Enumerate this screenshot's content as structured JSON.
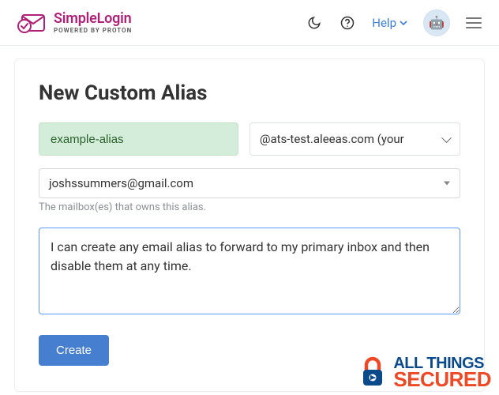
{
  "brand": {
    "name": "SimpleLogin",
    "tagline": "POWERED BY PROTON"
  },
  "header": {
    "help_label": "Help",
    "avatar_emoji": "🤖"
  },
  "page": {
    "title": "New Custom Alias",
    "alias_value": "example-alias",
    "domain_selected": "@ats-test.aleeas.com (your",
    "mailbox_selected": "joshssummers@gmail.com",
    "mailbox_helper": "The mailbox(es) that owns this alias.",
    "note_value": "I can create any email alias to forward to my primary inbox and then disable them at any time.",
    "create_label": "Create"
  },
  "watermark": {
    "line1": "ALL THINGS",
    "line2": "SECURED"
  },
  "colors": {
    "brand_pink": "#b02076",
    "primary_blue": "#467fcf",
    "link_blue": "#3b7ddd",
    "success_bg": "#d4edda",
    "wm_blue": "#0a4a8a",
    "wm_orange": "#ee4926"
  }
}
